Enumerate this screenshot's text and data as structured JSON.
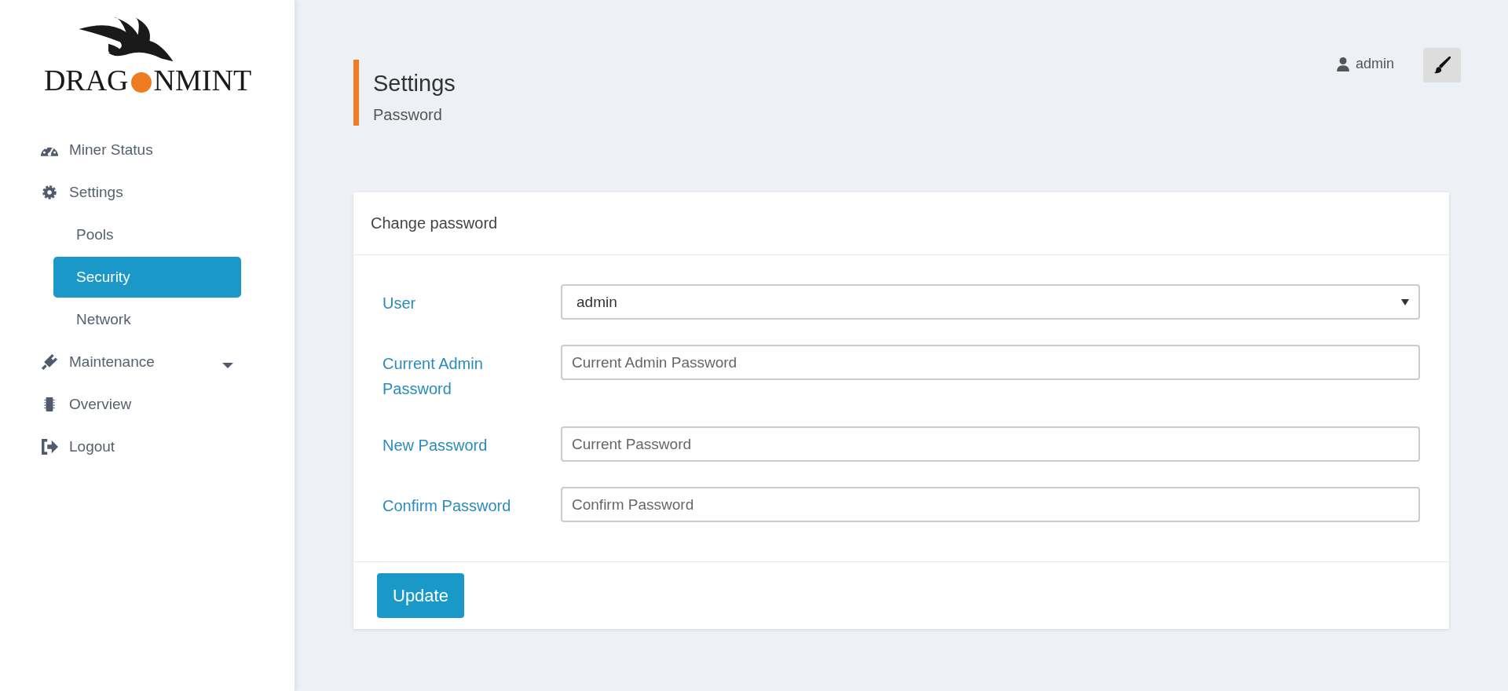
{
  "logo": {
    "parts": [
      "DRAG",
      "NMINT"
    ]
  },
  "sidebar": {
    "items": [
      {
        "label": "Miner Status",
        "kind": "main",
        "selected": false
      },
      {
        "label": "Settings",
        "kind": "main",
        "selected": false
      },
      {
        "label": "Pools",
        "kind": "sub",
        "selected": false
      },
      {
        "label": "Security",
        "kind": "sub",
        "selected": true
      },
      {
        "label": "Network",
        "kind": "sub",
        "selected": false
      },
      {
        "label": "Maintenance",
        "kind": "main",
        "selected": false,
        "expandable": true
      },
      {
        "label": "Overview",
        "kind": "main",
        "selected": false
      },
      {
        "label": "Logout",
        "kind": "main",
        "selected": false
      }
    ]
  },
  "header": {
    "title": "Settings",
    "subtitle": "Password",
    "user": "admin"
  },
  "card": {
    "title": "Change password",
    "fields": [
      {
        "label": "User",
        "kind": "select",
        "value": "admin"
      },
      {
        "label": "Current Admin Password",
        "kind": "text",
        "placeholder": "Current Admin Password"
      },
      {
        "label": "New Password",
        "kind": "text",
        "placeholder": "Current Password"
      },
      {
        "label": "Confirm Password",
        "kind": "text",
        "placeholder": "Confirm Password"
      }
    ],
    "button": "Update"
  }
}
